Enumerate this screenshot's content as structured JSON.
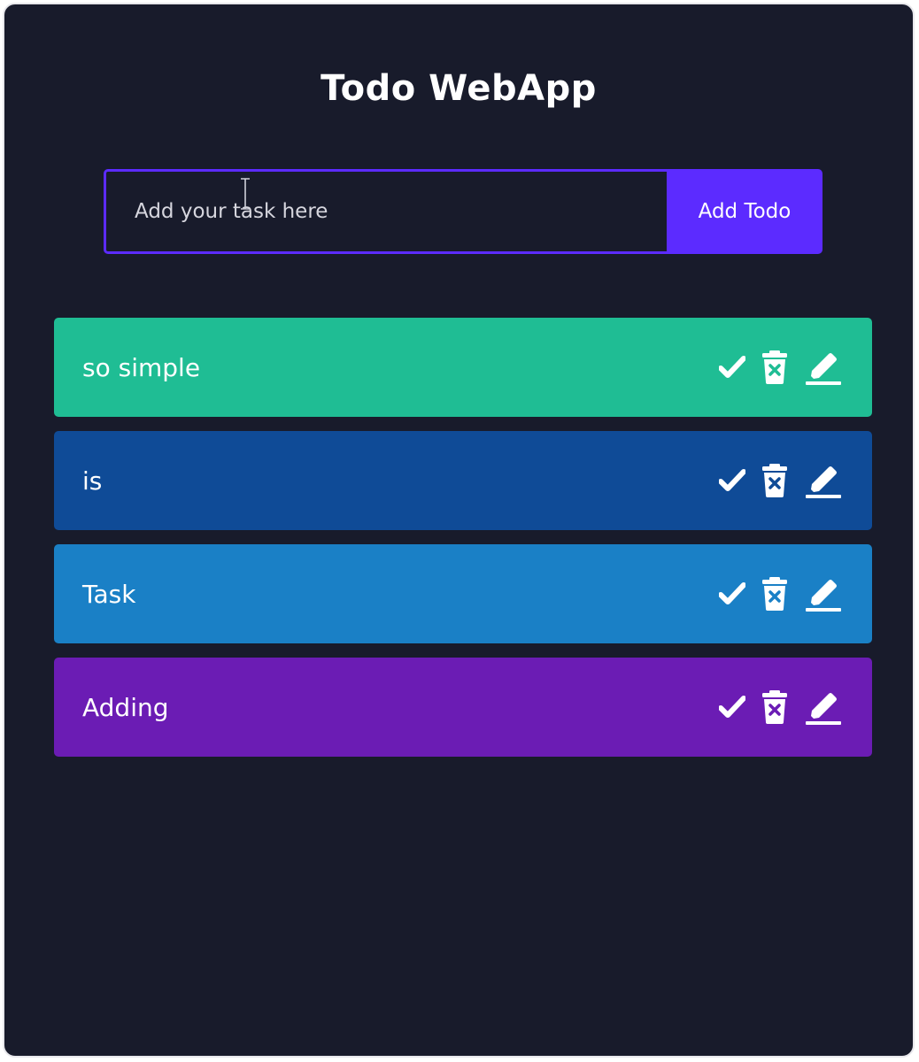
{
  "app": {
    "title": "Todo WebApp"
  },
  "form": {
    "input_placeholder": "Add your task here",
    "input_value": "",
    "add_button_label": "Add Todo"
  },
  "todos": [
    {
      "text": "so simple",
      "color": "#1fbd94"
    },
    {
      "text": "is",
      "color": "#0f4b97"
    },
    {
      "text": "Task",
      "color": "#1a80c6"
    },
    {
      "text": "Adding",
      "color": "#6b1cb4"
    }
  ],
  "icons": {
    "done": "check-icon",
    "delete": "trash-icon",
    "edit": "pen-icon"
  },
  "colors": {
    "background": "#181b2b",
    "accent": "#5c2bff"
  }
}
